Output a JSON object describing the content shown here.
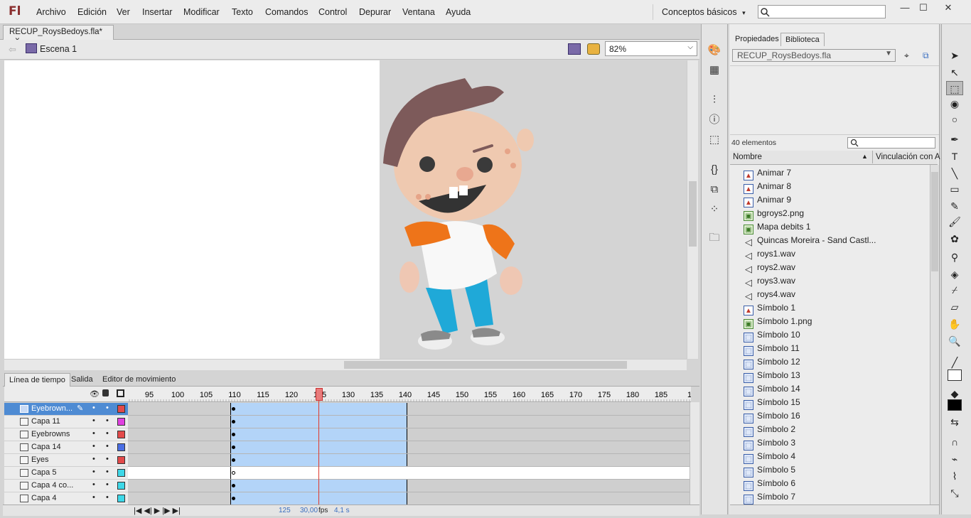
{
  "app": {
    "logo": "Fl"
  },
  "menu": [
    "Archivo",
    "Edición",
    "Ver",
    "Insertar",
    "Modificar",
    "Texto",
    "Comandos",
    "Control",
    "Depurar",
    "Ventana",
    "Ayuda"
  ],
  "workspace": {
    "label": "Conceptos básicos",
    "arrow": "▾"
  },
  "window": {
    "minimize": "—",
    "maximize": "☐",
    "close": "✕"
  },
  "document": {
    "tab": "RECUP_RoysBedoys.fla*",
    "close": "×",
    "scene": "Escena 1",
    "zoom": "82%"
  },
  "timeline": {
    "tabs": [
      "Línea de tiempo",
      "Salida",
      "Editor de movimiento"
    ],
    "ruler": [
      "95",
      "100",
      "105",
      "110",
      "115",
      "120",
      "125",
      "130",
      "135",
      "140",
      "145",
      "150",
      "155",
      "160",
      "165",
      "170",
      "175",
      "180",
      "185",
      "1"
    ],
    "current_frame": "125",
    "fps": "30,00",
    "fps_unit": "fps",
    "elapsed": "4,1 s",
    "layers": [
      {
        "name": "Eyebrown...",
        "color": "#e34a4a",
        "selected": true
      },
      {
        "name": "Capa 11",
        "color": "#e040e0"
      },
      {
        "name": "Eyebrowns",
        "color": "#e34a4a"
      },
      {
        "name": "Capa 14",
        "color": "#4a6ee3"
      },
      {
        "name": "Eyes",
        "color": "#e34a4a"
      },
      {
        "name": "Capa 5",
        "color": "#3ed8e8"
      },
      {
        "name": "Capa 4 co...",
        "color": "#3ed8e8"
      },
      {
        "name": "Capa 4",
        "color": "#3ed8e8"
      }
    ]
  },
  "library": {
    "tabs": [
      "Propiedades",
      "Biblioteca"
    ],
    "file": "RECUP_RoysBedoys.fla",
    "count": "40 elementos",
    "col_name": "Nombre",
    "col_link": "Vinculación con A",
    "items": [
      {
        "name": "Animar 7",
        "type": "graphic"
      },
      {
        "name": "Animar 8",
        "type": "graphic"
      },
      {
        "name": "Animar 9",
        "type": "graphic"
      },
      {
        "name": "bgroys2.png",
        "type": "bitmap"
      },
      {
        "name": "Mapa debits 1",
        "type": "bitmap"
      },
      {
        "name": "Quincas Moreira - Sand Castl...",
        "type": "sound"
      },
      {
        "name": "roys1.wav",
        "type": "sound"
      },
      {
        "name": "roys2.wav",
        "type": "sound"
      },
      {
        "name": "roys3.wav",
        "type": "sound"
      },
      {
        "name": "roys4.wav",
        "type": "sound"
      },
      {
        "name": "Símbolo 1",
        "type": "graphic"
      },
      {
        "name": "Símbolo 1.png",
        "type": "bitmap"
      },
      {
        "name": "Símbolo 10",
        "type": "symbol"
      },
      {
        "name": "Símbolo 11",
        "type": "symbol"
      },
      {
        "name": "Símbolo 12",
        "type": "symbol"
      },
      {
        "name": "Símbolo 13",
        "type": "symbol"
      },
      {
        "name": "Símbolo 14",
        "type": "symbol"
      },
      {
        "name": "Símbolo 15",
        "type": "symbol"
      },
      {
        "name": "Símbolo 16",
        "type": "symbol"
      },
      {
        "name": "Símbolo 2",
        "type": "symbol"
      },
      {
        "name": "Símbolo 3",
        "type": "symbol"
      },
      {
        "name": "Símbolo 4",
        "type": "symbol"
      },
      {
        "name": "Símbolo 5",
        "type": "symbol"
      },
      {
        "name": "Símbolo 6",
        "type": "symbol"
      },
      {
        "name": "Símbolo 7",
        "type": "symbol"
      }
    ]
  },
  "colors": {
    "accent": "#4e8bd3",
    "tween": "#b3d4f8",
    "playhead": "#e0392b"
  }
}
